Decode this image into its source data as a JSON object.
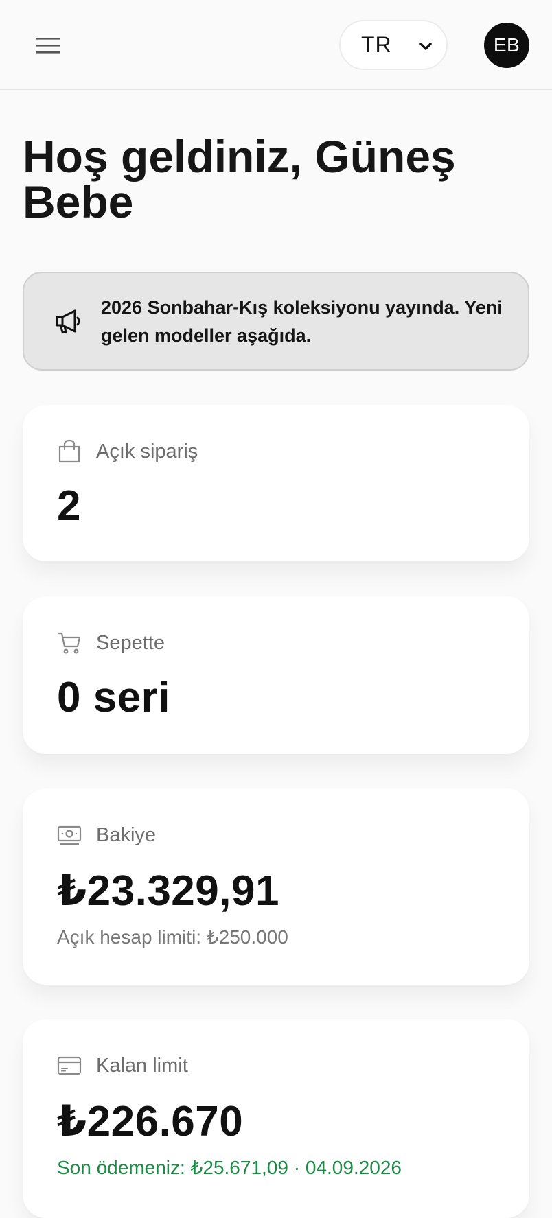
{
  "header": {
    "menu_icon": "hamburger-menu-icon",
    "language": {
      "selected": "TR"
    },
    "avatar_initials": "EB"
  },
  "welcome": {
    "title": "Hoş geldiniz, Güneş Bebe"
  },
  "announcement": {
    "icon": "megaphone-icon",
    "text": "2026 Sonbahar-Kış koleksiyonu yayında. Yeni gelen modeller aşağıda."
  },
  "cards": {
    "open_orders": {
      "icon": "shopping-bag-icon",
      "label": "Açık sipariş",
      "value": "2"
    },
    "cart": {
      "icon": "cart-icon",
      "label": "Sepette",
      "value": "0 seri"
    },
    "balance": {
      "icon": "banknote-icon",
      "label": "Bakiye",
      "value": "₺23.329,91",
      "sub": "Açık hesap limiti: ₺250.000"
    },
    "remaining_limit": {
      "icon": "credit-card-icon",
      "label": "Kalan limit",
      "value": "₺226.670",
      "sub": "Son ödemeniz: ₺25.671,09 · 04.09.2026"
    }
  },
  "colors": {
    "background": "#fafafa",
    "announcement_bg": "#e6e6e6",
    "avatar_bg": "#0d0d0d",
    "positive_text": "#1d8a45"
  }
}
